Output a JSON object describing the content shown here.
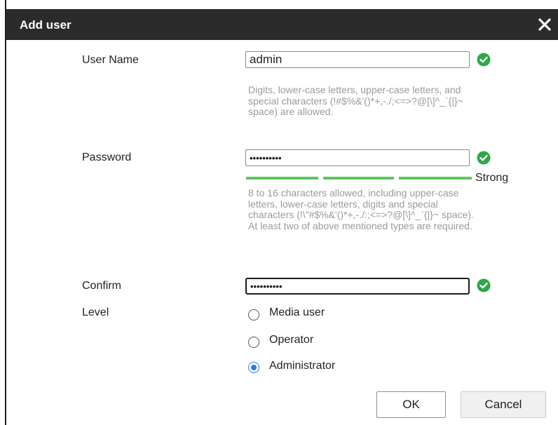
{
  "dialog": {
    "title": "Add user"
  },
  "form": {
    "username": {
      "label": "User Name",
      "value": "admin",
      "hint": "Digits, lower-case letters, upper-case letters, and special characters (!#$%&'()*+,-./;<=>?@[\\]^_`{|}~ space) are allowed."
    },
    "password": {
      "label": "Password",
      "value": "••••••••••",
      "strength": "Strong",
      "strength_color": "#5cc85c",
      "hint": "8 to 16 characters allowed, including upper-case letters, lower-case letters, digits and special characters (!\\\"#$%&'()*+,-./:;<=>?@[\\]^_`{|}~ space). At least two of above mentioned types are required."
    },
    "confirm": {
      "label": "Confirm",
      "value": "••••••••••"
    },
    "level": {
      "label": "Level",
      "options": [
        "Media user",
        "Operator",
        "Administrator"
      ],
      "selected": "Administrator"
    }
  },
  "buttons": {
    "ok": "OK",
    "cancel": "Cancel"
  },
  "icons": {
    "close": "close-icon",
    "valid": "check-circle-icon"
  },
  "colors": {
    "titlebar": "#2b2b2b",
    "valid": "#2ea84a",
    "accent": "#2a7be4"
  }
}
